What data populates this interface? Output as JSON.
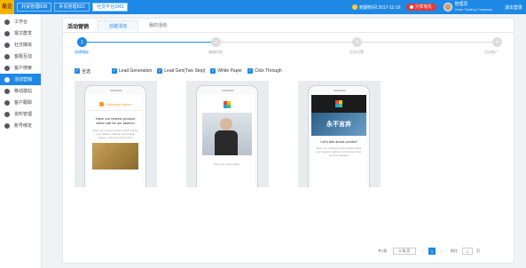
{
  "app": {
    "logo_text": "易企"
  },
  "topnav": {
    "tabs": [
      "外贸管理B2B",
      "外贸管理B2C",
      "社交平台SNS"
    ],
    "active_index": 2
  },
  "header_right": {
    "expiry": "到期时间 2017-11-16",
    "share_label": "分享有礼",
    "user_name": "管理员",
    "company": "Joker Trading Company",
    "logout": "退出登录"
  },
  "sidebar": {
    "items": [
      {
        "label": "工作台",
        "icon": "dashboard-icon"
      },
      {
        "label": "报文群发",
        "icon": "mail-icon"
      },
      {
        "label": "社交媒体",
        "icon": "share-icon"
      },
      {
        "label": "客服互动",
        "icon": "chat-icon"
      },
      {
        "label": "客户搜索",
        "icon": "search-icon"
      },
      {
        "label": "活动营销",
        "icon": "campaign-icon",
        "active": true
      },
      {
        "label": "移动建站",
        "icon": "mobile-icon"
      },
      {
        "label": "客户跟踪",
        "icon": "track-icon"
      },
      {
        "label": "资料管理",
        "icon": "folder-icon"
      },
      {
        "label": "账号绑定",
        "icon": "link-icon"
      }
    ]
  },
  "page": {
    "title": "活动营销",
    "tabs": [
      "创建活动",
      "我的活动"
    ],
    "active_tab": 0
  },
  "steps": [
    {
      "num": "1",
      "label": "选择模板",
      "active": true
    },
    {
      "num": "2",
      "label": "编辑内容",
      "active": false
    },
    {
      "num": "3",
      "label": "活动设置",
      "active": false
    },
    {
      "num": "4",
      "label": "活动推广",
      "active": false
    }
  ],
  "filters": [
    {
      "label": "全选",
      "checked": true
    },
    {
      "label": "Lead Generation",
      "checked": true
    },
    {
      "label": "Lead Gen(Two Step)",
      "checked": true
    },
    {
      "label": "White Paper",
      "checked": true
    },
    {
      "label": "Click Through",
      "checked": true
    }
  ],
  "templates": [
    {
      "brand": "Company Name",
      "headline": "Have our newest product which will be our fashion",
      "body": "Meet our newest product which will be your fashion, fashion and simple design, make the whole thing"
    },
    {
      "caption": "Meet our new product"
    },
    {
      "hero_text": "永不言弃",
      "headline": "Let's talk about comfort",
      "body": "Meet our newest product which will be your fashion, fashion and sharper than previous designs"
    }
  ],
  "pager": {
    "total_label": "共1条",
    "per_page": "8 条/页",
    "current_page": "1",
    "goto_label": "前往",
    "goto_value": "1",
    "page_suffix": "页"
  },
  "colors": {
    "primary": "#1e88e5",
    "share": "#e53935",
    "logo": "#f5b400"
  }
}
